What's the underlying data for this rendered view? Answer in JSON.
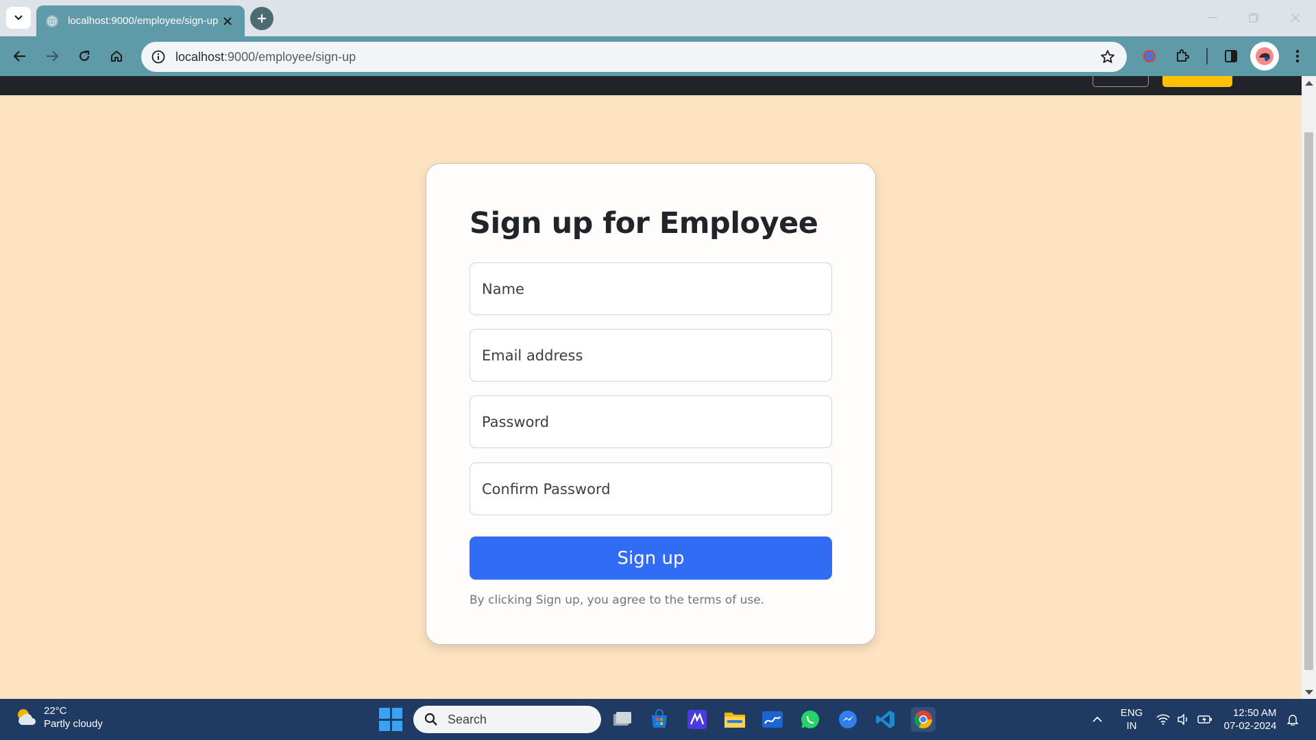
{
  "browser": {
    "tab_title": "localhost:9000/employee/sign-up",
    "url_host": "localhost",
    "url_path": ":9000/employee/sign-up"
  },
  "page": {
    "heading": "Sign up for Employee",
    "fields": {
      "name_placeholder": "Name",
      "email_placeholder": "Email address",
      "password_placeholder": "Password",
      "confirm_placeholder": "Confirm Password"
    },
    "signup_label": "Sign up",
    "terms_text": "By clicking Sign up, you agree to the terms of use.",
    "colors": {
      "background": "#fee3c1",
      "primary_button": "#316cf4",
      "navbar": "#212529",
      "navbar_warning_button": "#ffc107"
    }
  },
  "taskbar": {
    "weather_temp": "22°C",
    "weather_desc": "Partly cloudy",
    "search_label": "Search",
    "lang_line1": "ENG",
    "lang_line2": "IN",
    "time": "12:50 AM",
    "date": "07-02-2024",
    "apps": [
      "task-view-icon",
      "store-icon",
      "mathpix-icon",
      "file-explorer-icon",
      "whiteboard-icon",
      "whatsapp-icon",
      "messenger-icon",
      "vscode-icon",
      "chrome-icon"
    ]
  }
}
